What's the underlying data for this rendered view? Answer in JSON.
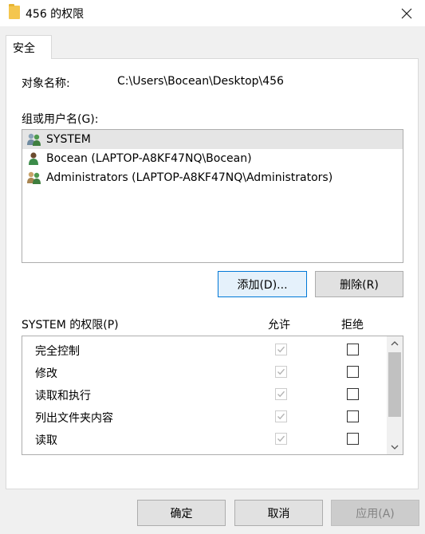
{
  "window": {
    "title": "456 的权限",
    "close_glyph": "✕"
  },
  "tab": {
    "label": "安全"
  },
  "object": {
    "label": "对象名称:",
    "value": "C:\\Users\\Bocean\\Desktop\\456"
  },
  "groups": {
    "label": "组或用户名(G):",
    "items": [
      {
        "name": "SYSTEM",
        "icon": "users-group-icon",
        "selected": true
      },
      {
        "name": "Bocean (LAPTOP-A8KF47NQ\\Bocean)",
        "icon": "user-icon",
        "selected": false
      },
      {
        "name": "Administrators (LAPTOP-A8KF47NQ\\Administrators)",
        "icon": "users-group-icon",
        "selected": false
      }
    ]
  },
  "buttons": {
    "add": "添加(D)...",
    "remove": "删除(R)",
    "ok": "确定",
    "cancel": "取消",
    "apply": "应用(A)"
  },
  "permissions": {
    "label": "SYSTEM 的权限(P)",
    "allow_header": "允许",
    "deny_header": "拒绝",
    "rows": [
      {
        "name": "完全控制",
        "allow": true,
        "deny": false
      },
      {
        "name": "修改",
        "allow": true,
        "deny": false
      },
      {
        "name": "读取和执行",
        "allow": true,
        "deny": false
      },
      {
        "name": "列出文件夹内容",
        "allow": true,
        "deny": false
      },
      {
        "name": "读取",
        "allow": true,
        "deny": false
      },
      {
        "name": "",
        "allow": true,
        "deny": false
      }
    ]
  },
  "colors": {
    "focus_border": "#0078d7",
    "selection": "#e5e5e5",
    "folder_icon": "#f4c64e"
  }
}
